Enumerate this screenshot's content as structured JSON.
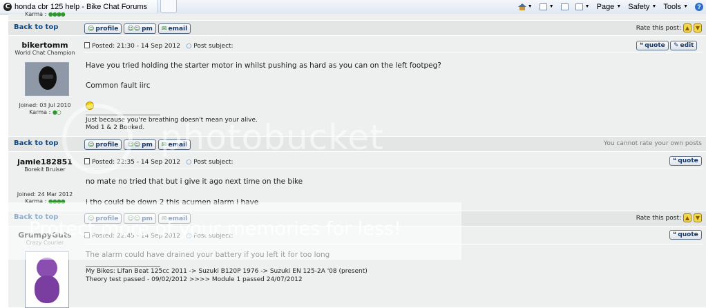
{
  "browser": {
    "tab_title": "honda cbr 125 help - Bike Chat Forums",
    "commands": {
      "page": "Page",
      "safety": "Safety",
      "tools": "Tools"
    }
  },
  "top_partial": {
    "karma_label": "Karma :"
  },
  "buttons": {
    "profile": "profile",
    "pm": "pm",
    "email": "email",
    "quote": "quote",
    "edit": "edit"
  },
  "back_to_top": "Back to top",
  "rate_label": "Rate this post:",
  "cannot_rate": "You cannot rate your own posts",
  "posts": [
    {
      "username": "bikertomm",
      "rank": "World Chat Champion",
      "joined": "Joined: 03 Jul 2010",
      "karma": "Karma :",
      "posted": "Posted: 21:30 - 14 Sep 2012",
      "subject": "Post subject:",
      "lines": [
        "Have you tried holding the starter motor in whilst pushing as hard as you can on the left footpeg?",
        "Common fault iirc"
      ],
      "signature": [
        "Just because you're breathing doesn't mean your alive.",
        "Mod 1 & 2 Booked."
      ]
    },
    {
      "username": "jamie182851",
      "rank": "Borekit Bruiser",
      "joined": "Joined: 24 Mar 2012",
      "karma": "Karma :",
      "posted": "Posted: 22:35 - 14 Sep 2012",
      "subject": "Post subject:",
      "lines": [
        "no mate no tried that but i give it ago next time on the bike",
        "i tho could be down 2 this acumen alarm i have"
      ]
    },
    {
      "username": "GrumpyGuts",
      "rank": "Crazy Courier",
      "posted": "Posted: 22:45 - 14 Sep 2012",
      "subject": "Post subject:",
      "lines": [
        "The alarm could have drained your battery if you left it for too long"
      ],
      "signature": [
        "My Bikes: Lifan Beat 125cc 2011 -> Suzuki B120P 1976 -> Suzuki EN 125-2A '08 (present)",
        "Theory test passed - 09/02/2012 >>>> Module 1 passed 24/07/2012"
      ]
    }
  ],
  "watermark": {
    "brand": "photobucket",
    "promo": "Protect more of your memories for less!"
  }
}
